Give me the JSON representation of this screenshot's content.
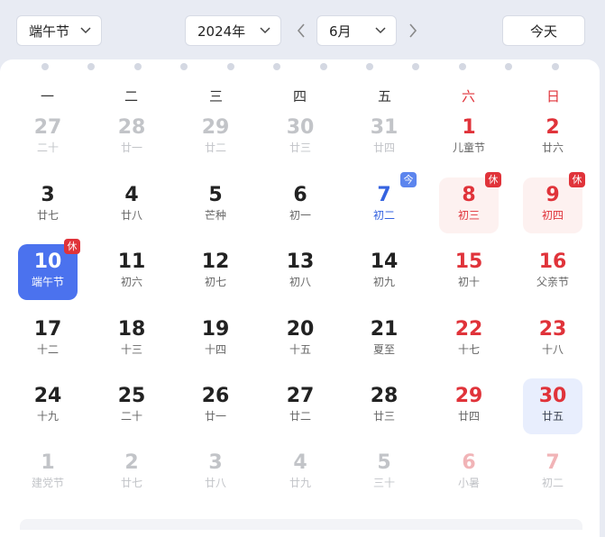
{
  "header": {
    "holiday_select": "端午节",
    "year_select": "2024年",
    "month_select": "6月",
    "today_button": "今天"
  },
  "weekdays": [
    "一",
    "二",
    "三",
    "四",
    "五",
    "六",
    "日"
  ],
  "days": [
    {
      "num": "27",
      "lunar": "二十",
      "state": "out"
    },
    {
      "num": "28",
      "lunar": "廿一",
      "state": "out"
    },
    {
      "num": "29",
      "lunar": "廿二",
      "state": "out"
    },
    {
      "num": "30",
      "lunar": "廿三",
      "state": "out"
    },
    {
      "num": "31",
      "lunar": "廿四",
      "state": "out"
    },
    {
      "num": "1",
      "lunar": "儿童节",
      "state": "wknd"
    },
    {
      "num": "2",
      "lunar": "廿六",
      "state": "wknd"
    },
    {
      "num": "3",
      "lunar": "廿七",
      "state": "normal"
    },
    {
      "num": "4",
      "lunar": "廿八",
      "state": "normal"
    },
    {
      "num": "5",
      "lunar": "芒种",
      "state": "normal"
    },
    {
      "num": "6",
      "lunar": "初一",
      "state": "normal"
    },
    {
      "num": "7",
      "lunar": "初二",
      "state": "today",
      "badge": "今"
    },
    {
      "num": "8",
      "lunar": "初三",
      "state": "rest",
      "badge": "休"
    },
    {
      "num": "9",
      "lunar": "初四",
      "state": "rest",
      "badge": "休"
    },
    {
      "num": "10",
      "lunar": "端午节",
      "state": "selected",
      "badge": "休"
    },
    {
      "num": "11",
      "lunar": "初六",
      "state": "normal"
    },
    {
      "num": "12",
      "lunar": "初七",
      "state": "normal"
    },
    {
      "num": "13",
      "lunar": "初八",
      "state": "normal"
    },
    {
      "num": "14",
      "lunar": "初九",
      "state": "normal"
    },
    {
      "num": "15",
      "lunar": "初十",
      "state": "wknd"
    },
    {
      "num": "16",
      "lunar": "父亲节",
      "state": "wknd"
    },
    {
      "num": "17",
      "lunar": "十二",
      "state": "normal"
    },
    {
      "num": "18",
      "lunar": "十三",
      "state": "normal"
    },
    {
      "num": "19",
      "lunar": "十四",
      "state": "normal"
    },
    {
      "num": "20",
      "lunar": "十五",
      "state": "normal"
    },
    {
      "num": "21",
      "lunar": "夏至",
      "state": "normal"
    },
    {
      "num": "22",
      "lunar": "十七",
      "state": "wknd"
    },
    {
      "num": "23",
      "lunar": "十八",
      "state": "wknd"
    },
    {
      "num": "24",
      "lunar": "十九",
      "state": "normal"
    },
    {
      "num": "25",
      "lunar": "二十",
      "state": "normal"
    },
    {
      "num": "26",
      "lunar": "廿一",
      "state": "normal"
    },
    {
      "num": "27",
      "lunar": "廿二",
      "state": "normal"
    },
    {
      "num": "28",
      "lunar": "廿三",
      "state": "normal"
    },
    {
      "num": "29",
      "lunar": "廿四",
      "state": "wknd"
    },
    {
      "num": "30",
      "lunar": "廿五",
      "state": "highlight"
    },
    {
      "num": "1",
      "lunar": "建党节",
      "state": "out"
    },
    {
      "num": "2",
      "lunar": "廿七",
      "state": "out"
    },
    {
      "num": "3",
      "lunar": "廿八",
      "state": "out"
    },
    {
      "num": "4",
      "lunar": "廿九",
      "state": "out"
    },
    {
      "num": "5",
      "lunar": "三十",
      "state": "out"
    },
    {
      "num": "6",
      "lunar": "小暑",
      "state": "out-wknd"
    },
    {
      "num": "7",
      "lunar": "初二",
      "state": "out-wknd"
    }
  ],
  "colors": {
    "accent": "#4b72ee",
    "weekend_red": "#e0333a",
    "rest_bg": "#fdf1f0",
    "page_bg": "#e8ebf3"
  }
}
